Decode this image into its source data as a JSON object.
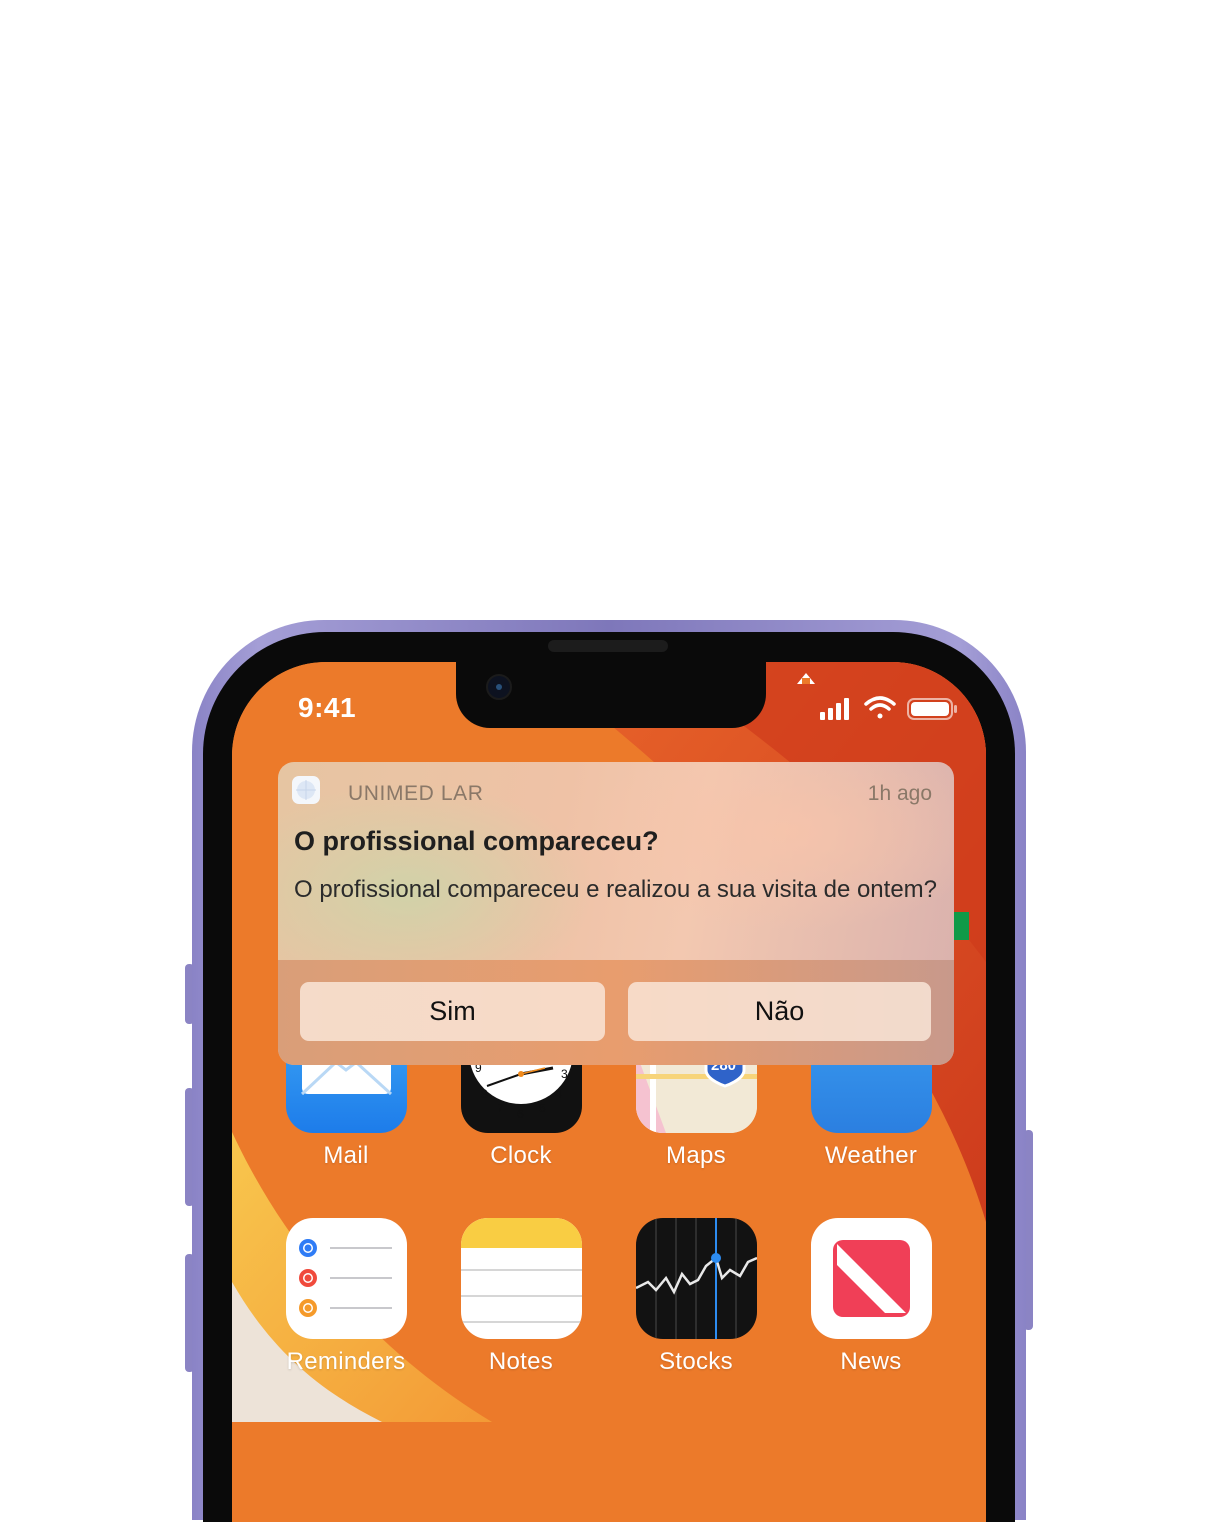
{
  "status_bar": {
    "time": "9:41"
  },
  "notification": {
    "app_name": "UNIMED LAR",
    "time": "1h ago",
    "title": "O profissional compareceu?",
    "message": "O profissional compareceu e realizou a sua visita de ontem?",
    "actions": [
      {
        "label": "Sim"
      },
      {
        "label": "Não"
      }
    ]
  },
  "home_screen": {
    "row1": [
      {
        "label": "Mail",
        "icon": "mail-icon"
      },
      {
        "label": "Clock",
        "icon": "clock-icon"
      },
      {
        "label": "Maps",
        "icon": "maps-icon"
      },
      {
        "label": "Weather",
        "icon": "weather-icon"
      }
    ],
    "row2": [
      {
        "label": "Reminders",
        "icon": "reminders-icon"
      },
      {
        "label": "Notes",
        "icon": "notes-icon"
      },
      {
        "label": "Stocks",
        "icon": "stocks-icon"
      },
      {
        "label": "News",
        "icon": "news-icon"
      }
    ],
    "maps_badge": "280",
    "clock_numbers": [
      "9",
      "3",
      "4",
      "5",
      "6",
      "7",
      "8"
    ]
  },
  "colors": {
    "frame": "#8a83c6",
    "wallpaper_orange": "#ec7a2a",
    "wallpaper_red": "#d2351a",
    "wallpaper_yellow": "#f7c14a"
  }
}
